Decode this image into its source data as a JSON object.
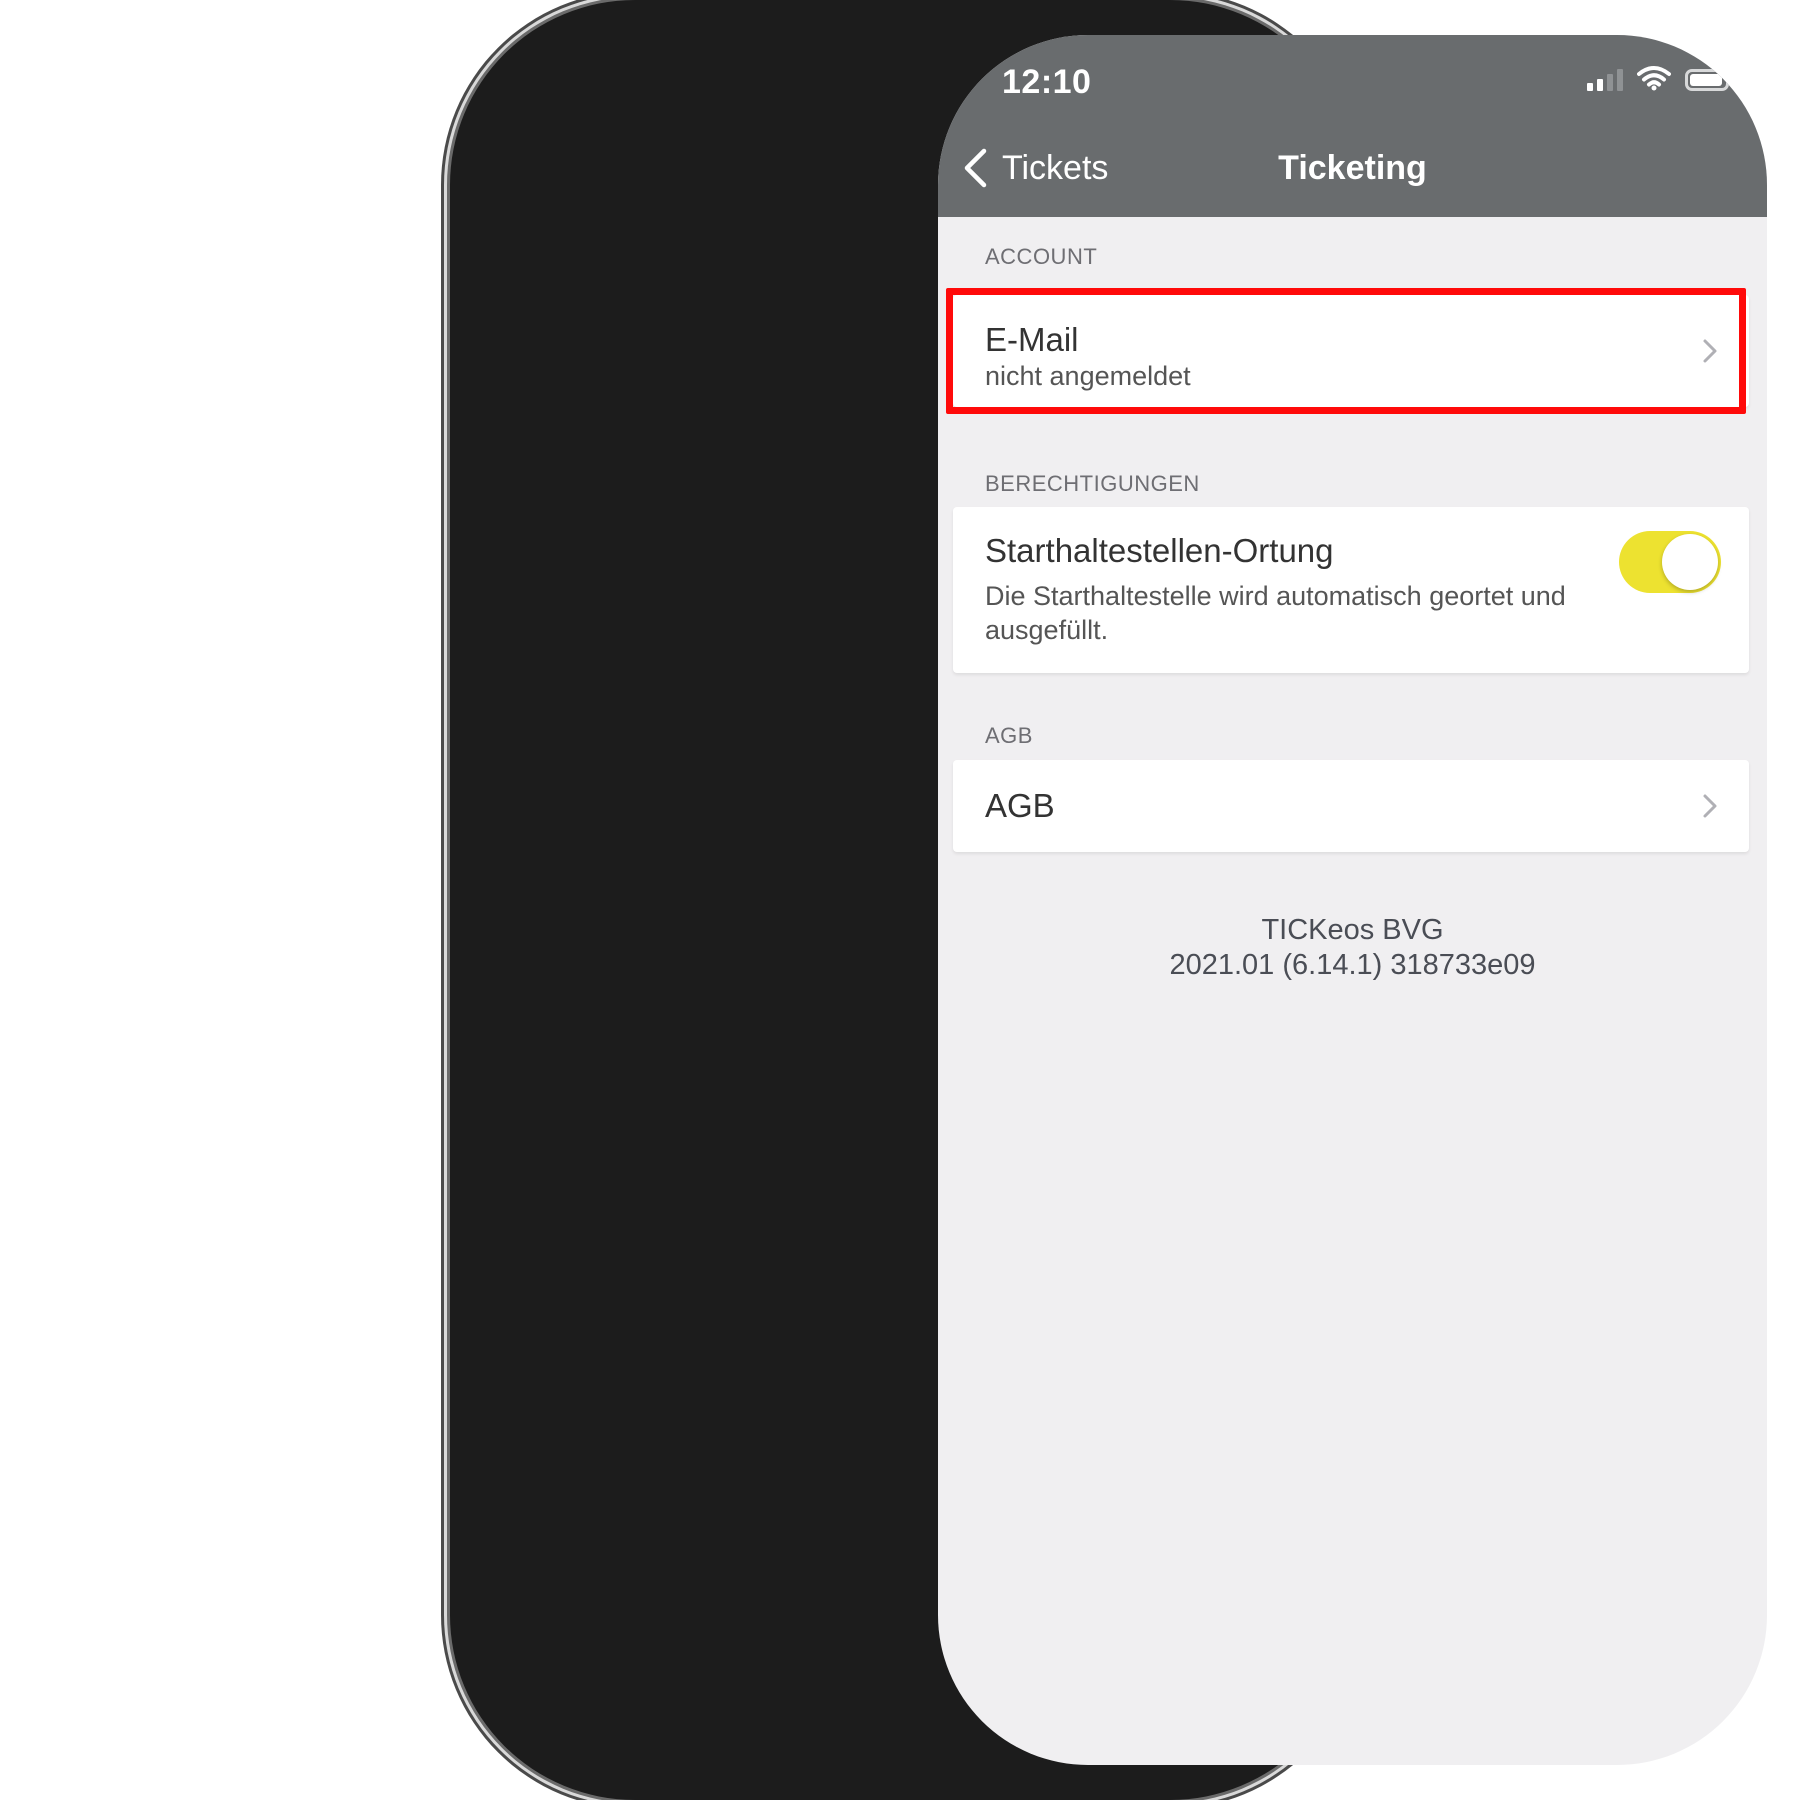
{
  "status_bar": {
    "time": "12:10"
  },
  "nav": {
    "back_label": "Tickets",
    "title": "Ticketing"
  },
  "sections": {
    "account": {
      "header": "ACCOUNT",
      "email": {
        "title": "E-Mail",
        "subtitle": "nicht angemeldet"
      }
    },
    "permissions": {
      "header": "BERECHTIGUNGEN",
      "location": {
        "title": "Starthaltestellen-Ortung",
        "description": "Die Starthaltestelle wird automatisch geortet und ausgefüllt.",
        "toggle_on": true
      }
    },
    "agb": {
      "header": "AGB",
      "item": {
        "title": "AGB"
      }
    }
  },
  "footer": {
    "app_name": "TICKeos BVG",
    "version": "2021.01 (6.14.1) 318733e09"
  },
  "colors": {
    "navbar": "#696c6e",
    "toggle": "#ede230",
    "highlight": "#ff0a0a",
    "background": "#f0eff1"
  }
}
